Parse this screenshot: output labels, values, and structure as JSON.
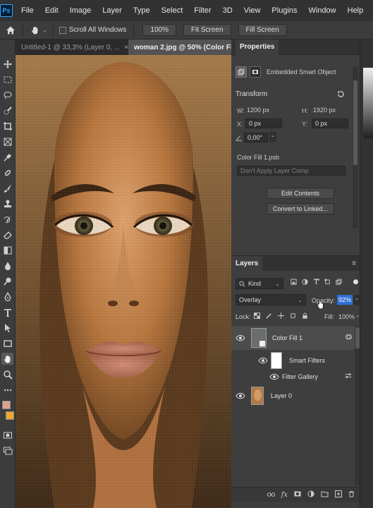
{
  "menubar": {
    "logo": "Ps",
    "items": [
      "File",
      "Edit",
      "Image",
      "Layer",
      "Type",
      "Select",
      "Filter",
      "3D",
      "View",
      "Plugins",
      "Window",
      "Help"
    ]
  },
  "options": {
    "scroll_all_windows": "Scroll All Windows",
    "zoom": "100%",
    "fit_screen": "Fit Screen",
    "fill_screen": "Fill Screen"
  },
  "tabs": [
    {
      "label": "Untitled-1 @ 33,3% (Layer 0, ..."
    },
    {
      "label": "woman 2.jpg @ 50% (Color Fi"
    }
  ],
  "properties": {
    "title": "Properties",
    "embedded": "Embedded Smart Object",
    "transform": "Transform",
    "w_label": "W:",
    "w_value": "1200 px",
    "h_label": "H:",
    "h_value": "1920 px",
    "x_label": "X:",
    "x_value": "0 px",
    "y_label": "Y:",
    "y_value": "0 px",
    "angle_value": "0,00°",
    "source_file": "Color Fill 1.psb",
    "layer_comp": "Don't Apply Layer Comp",
    "edit_contents": "Edit Contents",
    "convert": "Convert to Linked..."
  },
  "layers": {
    "title": "Layers",
    "kind": "Kind",
    "blend_mode": "Overlay",
    "opacity_label": "Opacity:",
    "opacity_value": "92%",
    "lock_label": "Lock:",
    "fill_label": "Fill:",
    "fill_value": "100%",
    "items": [
      {
        "name": "Color Fill 1"
      },
      {
        "name": "Smart Filters"
      },
      {
        "name": "Filter Gallery"
      },
      {
        "name": "Layer 0"
      }
    ]
  },
  "colors": {
    "foreground": "#d9a68c",
    "background": "#f0a830"
  }
}
